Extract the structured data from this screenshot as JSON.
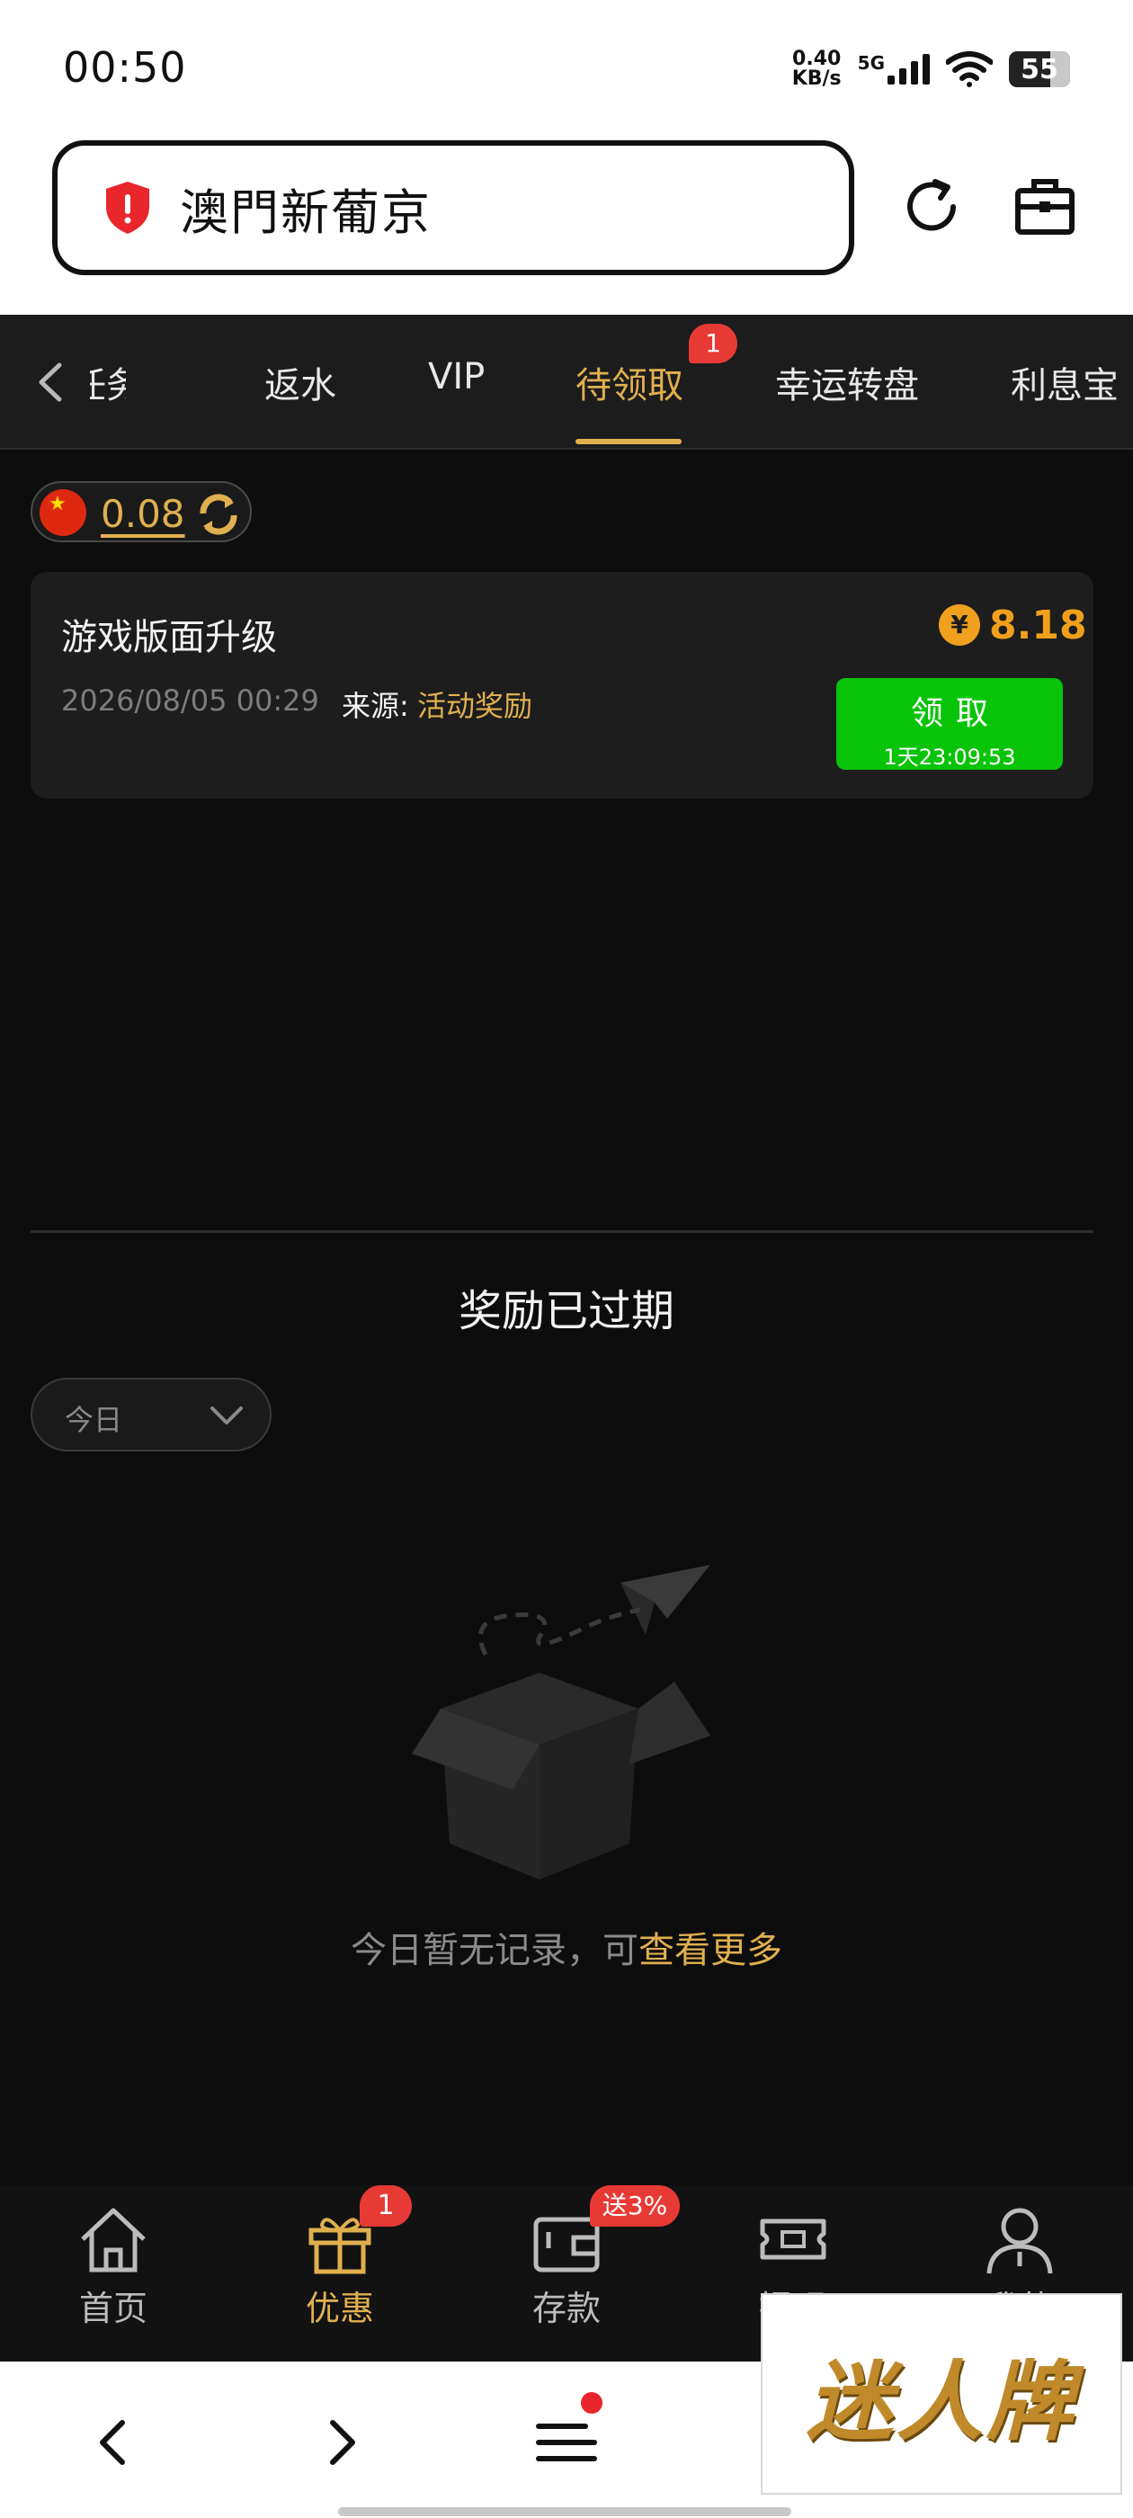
{
  "status_bar": {
    "time": "00:50",
    "net_speed_value": "0.40",
    "net_speed_unit": "KB/s",
    "network": "5G",
    "battery": "55"
  },
  "browser": {
    "site_title": "澳門新葡京"
  },
  "tabs": [
    {
      "label": "任务"
    },
    {
      "label": "返水"
    },
    {
      "label": "VIP"
    },
    {
      "label": "待领取",
      "badge": "1"
    },
    {
      "label": "幸运转盘"
    },
    {
      "label": "利息宝"
    }
  ],
  "balance": {
    "amount": "0.08"
  },
  "reward_card": {
    "title": "游戏版面升级",
    "datetime": "2026/08/05 00:29",
    "source_label": "来源:",
    "source_value": "活动奖励",
    "coin_symbol": "¥",
    "amount": "8.18",
    "claim_label": "领取",
    "countdown": "1天23:09:53"
  },
  "expired": {
    "title": "奖励已过期",
    "date_filter": "今日",
    "empty_text": "今日暂无记录，可",
    "empty_link": "查看更多"
  },
  "bottom_nav": [
    {
      "label": "首页",
      "icon": "home-icon"
    },
    {
      "label": "优惠",
      "icon": "gift-icon",
      "badge": "1"
    },
    {
      "label": "存款",
      "icon": "wallet-icon",
      "badge": "送3%"
    },
    {
      "label": "提现",
      "icon": "withdraw-icon"
    },
    {
      "label": "我的",
      "icon": "user-icon"
    }
  ],
  "watermark": "迷人牌",
  "colors": {
    "accent": "#e0b04f",
    "claim_green": "#08c408",
    "badge_red": "#e83a35",
    "coin_orange": "#f0a01c"
  }
}
